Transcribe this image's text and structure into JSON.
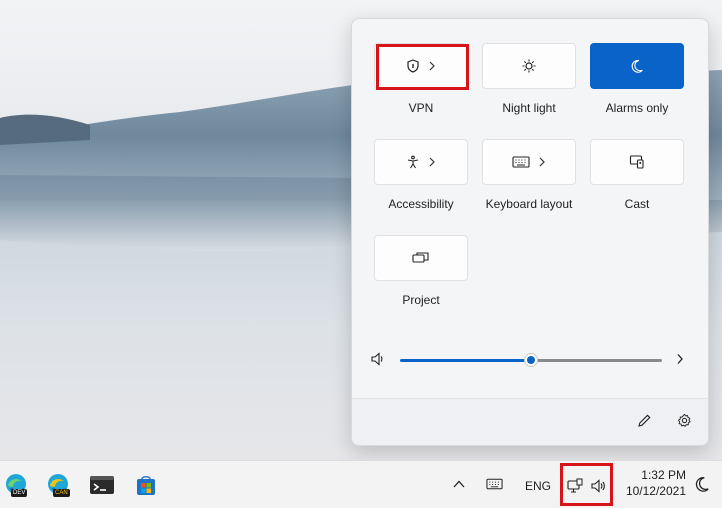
{
  "quick_settings": {
    "tiles": [
      {
        "key": "vpn",
        "label": "VPN",
        "icon": "shield-icon",
        "has_chevron": true,
        "active": false,
        "highlighted": true
      },
      {
        "key": "night-light",
        "label": "Night light",
        "icon": "brightness-icon",
        "has_chevron": false,
        "active": false
      },
      {
        "key": "alarms-only",
        "label": "Alarms only",
        "icon": "moon-icon",
        "has_chevron": false,
        "active": true
      },
      {
        "key": "accessibility",
        "label": "Accessibility",
        "icon": "accessibility-icon",
        "has_chevron": true,
        "active": false
      },
      {
        "key": "keyboard-layout",
        "label": "Keyboard layout",
        "icon": "keyboard-icon",
        "has_chevron": true,
        "active": false
      },
      {
        "key": "cast",
        "label": "Cast",
        "icon": "cast-icon",
        "has_chevron": false,
        "active": false
      },
      {
        "key": "project",
        "label": "Project",
        "icon": "project-icon",
        "has_chevron": false,
        "active": false
      }
    ],
    "volume": {
      "icon": "speaker-icon",
      "level_fraction": 0.5,
      "more_icon": "chevron-right-icon"
    },
    "footer": {
      "edit_icon": "pencil-icon",
      "settings_icon": "gear-icon"
    }
  },
  "taskbar": {
    "apps": [
      {
        "name": "edge-dev-icon",
        "badge": "DEV"
      },
      {
        "name": "edge-canary-icon",
        "badge": "CAN"
      },
      {
        "name": "terminal-icon"
      },
      {
        "name": "store-icon"
      }
    ],
    "tray": {
      "language": "ENG",
      "time": "1:32 PM",
      "date": "10/12/2021"
    }
  },
  "colors": {
    "accent": "#0a63c9",
    "highlight": "#d8141b"
  }
}
